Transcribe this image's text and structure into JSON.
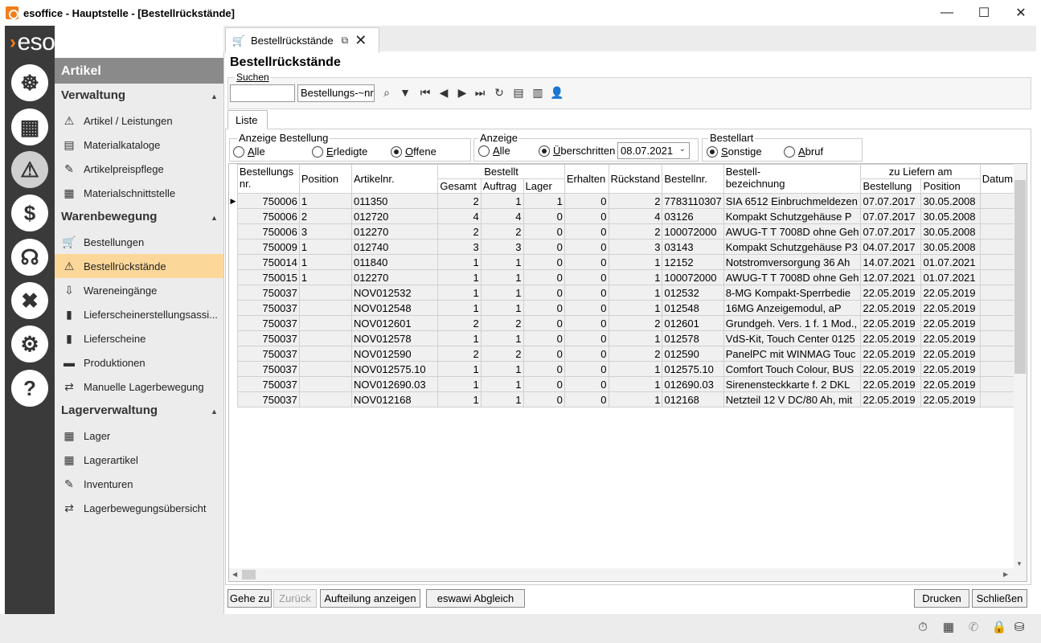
{
  "window": {
    "title": "esoffice - Hauptstelle - [Bestellrückstände]",
    "minimize": "—",
    "maximize": "☐",
    "close": "✕"
  },
  "logo": {
    "chevron": "›",
    "text": "esoffice"
  },
  "left_nav": [
    {
      "name": "dashboard-nav-icon",
      "glyph": "☸"
    },
    {
      "name": "calendar-nav-icon",
      "glyph": "▦"
    },
    {
      "name": "alarm-light-nav-icon",
      "glyph": "⚠"
    },
    {
      "name": "money-nav-icon",
      "glyph": "$"
    },
    {
      "name": "headset-nav-icon",
      "glyph": "☊"
    },
    {
      "name": "tools-nav-icon",
      "glyph": "✖"
    },
    {
      "name": "settings-nav-icon",
      "glyph": "⚙"
    },
    {
      "name": "help-nav-icon",
      "glyph": "?"
    }
  ],
  "module": {
    "header": "Artikel",
    "groups": [
      {
        "title": "Verwaltung",
        "items": [
          "Artikel / Leistungen",
          "Materialkataloge",
          "Artikelpreispflege",
          "Materialschnittstelle"
        ]
      },
      {
        "title": "Warenbewegung",
        "items": [
          "Bestellungen",
          "Bestellrückstände",
          "Wareneingänge",
          "Lieferscheinerstellungsassi...",
          "Lieferscheine",
          "Produktionen",
          "Manuelle Lagerbewegung"
        ]
      },
      {
        "title": "Lagerverwaltung",
        "items": [
          "Lager",
          "Lagerartikel",
          "Inventuren",
          "Lagerbewegungsübersicht"
        ]
      }
    ],
    "active_item": "Bestellrückstände"
  },
  "tab": {
    "label": "Bestellrückstände",
    "popout_icon": "⧉",
    "close_icon": "✕"
  },
  "page": {
    "title": "Bestellrückstände"
  },
  "search": {
    "legend": "Suchen",
    "value": "",
    "field": "Bestellungs-~nr"
  },
  "list_tab": "Liste",
  "filters": {
    "anzeige_bestellung": {
      "legend": "Anzeige Bestellung",
      "options": [
        "Alle",
        "Erledigte",
        "Offene"
      ],
      "selected": "Offene"
    },
    "anzeige": {
      "legend": "Anzeige",
      "options": [
        "Alle",
        "Überschritten"
      ],
      "selected": "Überschritten",
      "date": "08.07.2021"
    },
    "bestellart": {
      "legend": "Bestellart",
      "options": [
        "Sonstige",
        "Abruf"
      ],
      "selected": "Sonstige"
    }
  },
  "grid": {
    "headers": {
      "bestellungsnr_1": "Bestellungs",
      "bestellungsnr_2": "nr.",
      "position": "Position",
      "artikelnr": "Artikelnr.",
      "bestellt": "Bestellt",
      "gesamt": "Gesamt",
      "auftrag": "Auftrag",
      "lager": "Lager",
      "erhalten": "Erhalten",
      "rueckstand": "Rückstand",
      "bestellnr": "Bestellnr.",
      "bez_1": "Bestell-",
      "bez_2": "bezeichnung",
      "zu_liefern": "zu Liefern am",
      "bestellung": "Bestellung",
      "pos_datum": "Position",
      "datum": "Datum"
    },
    "rows": [
      [
        "750006",
        "1",
        "011350",
        "2",
        "1",
        "1",
        "0",
        "2",
        "7783110307",
        "SIA 6512 Einbruchmeldezen",
        "07.07.2017",
        "30.05.2008"
      ],
      [
        "750006",
        "2",
        "012720",
        "4",
        "4",
        "0",
        "0",
        "4",
        "03126",
        "Kompakt Schutzgehäuse P",
        "07.07.2017",
        "30.05.2008"
      ],
      [
        "750006",
        "3",
        "012270",
        "2",
        "2",
        "0",
        "0",
        "2",
        "100072000",
        "AWUG-T T 7008D ohne Geh",
        "07.07.2017",
        "30.05.2008"
      ],
      [
        "750009",
        "1",
        "012740",
        "3",
        "3",
        "0",
        "0",
        "3",
        "03143",
        "Kompakt Schutzgehäuse P3",
        "04.07.2017",
        "30.05.2008"
      ],
      [
        "750014",
        "1",
        "011840",
        "1",
        "1",
        "0",
        "0",
        "1",
        "12152",
        "Notstromversorgung 36 Ah",
        "14.07.2021",
        "01.07.2021"
      ],
      [
        "750015",
        "1",
        "012270",
        "1",
        "1",
        "0",
        "0",
        "1",
        "100072000",
        "AWUG-T T 7008D ohne Geh",
        "12.07.2021",
        "01.07.2021"
      ],
      [
        "750037",
        "",
        "NOV012532",
        "1",
        "1",
        "0",
        "0",
        "1",
        "012532",
        "8-MG Kompakt-Sperrbedie",
        "22.05.2019",
        "22.05.2019"
      ],
      [
        "750037",
        "",
        "NOV012548",
        "1",
        "1",
        "0",
        "0",
        "1",
        "012548",
        "16MG Anzeigemodul, aP",
        "22.05.2019",
        "22.05.2019"
      ],
      [
        "750037",
        "",
        "NOV012601",
        "2",
        "2",
        "0",
        "0",
        "2",
        "012601",
        "Grundgeh. Vers. 1 f. 1 Mod.,",
        "22.05.2019",
        "22.05.2019"
      ],
      [
        "750037",
        "",
        "NOV012578",
        "1",
        "1",
        "0",
        "0",
        "1",
        "012578",
        "VdS-Kit, Touch Center 0125",
        "22.05.2019",
        "22.05.2019"
      ],
      [
        "750037",
        "",
        "NOV012590",
        "2",
        "2",
        "0",
        "0",
        "2",
        "012590",
        "PanelPC mit WINMAG Touc",
        "22.05.2019",
        "22.05.2019"
      ],
      [
        "750037",
        "",
        "NOV012575.10",
        "1",
        "1",
        "0",
        "0",
        "1",
        "012575.10",
        "Comfort Touch Colour, BUS",
        "22.05.2019",
        "22.05.2019"
      ],
      [
        "750037",
        "",
        "NOV012690.03",
        "1",
        "1",
        "0",
        "0",
        "1",
        "012690.03",
        "Sirenensteckkarte f. 2 DKL",
        "22.05.2019",
        "22.05.2019"
      ],
      [
        "750037",
        "",
        "NOV012168",
        "1",
        "1",
        "0",
        "0",
        "1",
        "012168",
        "Netzteil 12 V DC/80 Ah, mit",
        "22.05.2019",
        "22.05.2019"
      ]
    ]
  },
  "buttons": {
    "gehe_zu": "Gehe zu",
    "zurueck": "Zurück",
    "aufteilung": "Aufteilung anzeigen",
    "eswawi": "eswawi Abgleich",
    "drucken": "Drucken",
    "schliessen": "Schließen"
  },
  "accent_color": "#f07d1a",
  "active_item_color": "#fbd89a"
}
